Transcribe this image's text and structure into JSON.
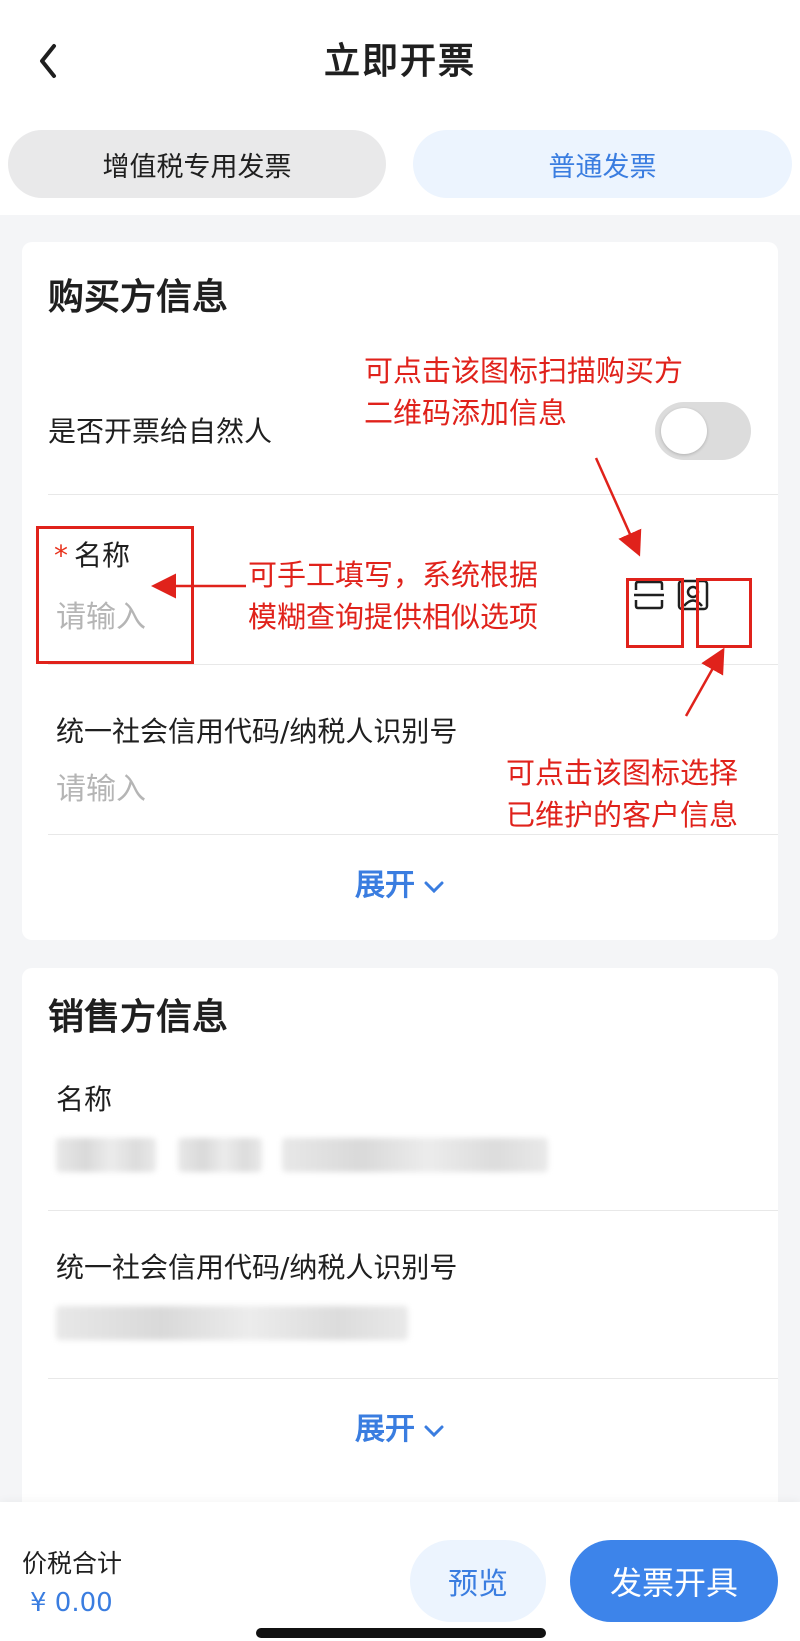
{
  "header": {
    "title": "立即开票"
  },
  "tabs": [
    {
      "label": "增值税专用发票",
      "active": false
    },
    {
      "label": "普通发票",
      "active": true
    }
  ],
  "buyer": {
    "title": "购买方信息",
    "natural_person_label": "是否开票给自然人",
    "natural_person_on": false,
    "name_star": "*",
    "name_label": "名称",
    "name_placeholder": "请输入",
    "tax_id_label": "统一社会信用代码/纳税人识别号",
    "tax_id_placeholder": "请输入",
    "expand_label": "展开"
  },
  "seller": {
    "title": "销售方信息",
    "name_label": "名称",
    "tax_id_label": "统一社会信用代码/纳税人识别号",
    "expand_label": "展开"
  },
  "annotations": {
    "scan_hint_line1": "可点击该图标扫描购买方",
    "scan_hint_line2": "二维码添加信息",
    "name_hint_line1": "可手工填写，系统根据",
    "name_hint_line2": "模糊查询提供相似选项",
    "contact_hint_line1": "可点击该图标选择",
    "contact_hint_line2": "已维护的客户信息"
  },
  "footer": {
    "total_label": "价税合计",
    "total_value": "¥ 0.00",
    "preview_label": "预览",
    "issue_label": "发票开具"
  },
  "colors": {
    "accent": "#3a7de0",
    "annotation": "#e0221b",
    "required": "#e8321c"
  }
}
